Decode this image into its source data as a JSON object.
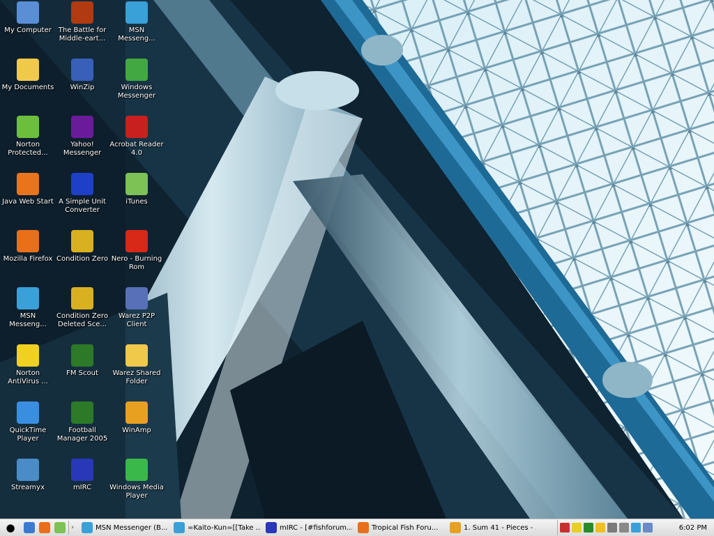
{
  "desktop": {
    "icons": [
      {
        "label": "My Computer",
        "icon": "my-computer-icon",
        "color": "#5a8fd6"
      },
      {
        "label": "The Battle for Middle-eart...",
        "icon": "battle-middle-earth-icon",
        "color": "#b23a10"
      },
      {
        "label": "MSN Messeng...",
        "icon": "msn-messenger-icon",
        "color": "#3aa0d8"
      },
      {
        "label": "My Documents",
        "icon": "my-documents-icon",
        "color": "#f0c84a"
      },
      {
        "label": "WinZip",
        "icon": "winzip-icon",
        "color": "#3860b8"
      },
      {
        "label": "Windows Messenger",
        "icon": "windows-messenger-icon",
        "color": "#42a842"
      },
      {
        "label": "Norton Protected...",
        "icon": "norton-recycle-bin-icon",
        "color": "#6cbf3c"
      },
      {
        "label": "Yahoo! Messenger",
        "icon": "yahoo-messenger-icon",
        "color": "#6a1b9a"
      },
      {
        "label": "Acrobat Reader 4.0",
        "icon": "acrobat-reader-icon",
        "color": "#c8201e"
      },
      {
        "label": "Java Web Start",
        "icon": "java-web-start-icon",
        "color": "#e8741e"
      },
      {
        "label": "A Simple Unit Converter",
        "icon": "unit-converter-icon",
        "color": "#1e3fc8"
      },
      {
        "label": "iTunes",
        "icon": "itunes-icon",
        "color": "#7cc254"
      },
      {
        "label": "Mozilla Firefox",
        "icon": "firefox-icon",
        "color": "#e8701a"
      },
      {
        "label": "Condition Zero",
        "icon": "condition-zero-icon",
        "color": "#d8b020"
      },
      {
        "label": "Nero - Burning Rom",
        "icon": "nero-icon",
        "color": "#d82818"
      },
      {
        "label": "MSN Messeng...",
        "icon": "msn-messenger-icon",
        "color": "#3aa0d8"
      },
      {
        "label": "Condition Zero Deleted Sce...",
        "icon": "condition-zero-deleted-scenes-icon",
        "color": "#d8b020"
      },
      {
        "label": "Warez P2P Client",
        "icon": "warez-p2p-icon",
        "color": "#5870b8"
      },
      {
        "label": "Norton AntiVirus ...",
        "icon": "norton-antivirus-icon",
        "color": "#f0d020"
      },
      {
        "label": "FM Scout",
        "icon": "fm-scout-icon",
        "color": "#2c7a28"
      },
      {
        "label": "Warez Shared Folder",
        "icon": "folder-icon",
        "color": "#f0c84a"
      },
      {
        "label": "QuickTime Player",
        "icon": "quicktime-icon",
        "color": "#3a8ee0"
      },
      {
        "label": "Football Manager 2005",
        "icon": "football-manager-icon",
        "color": "#2c7a28"
      },
      {
        "label": "WinAmp",
        "icon": "winamp-icon",
        "color": "#e8a020"
      },
      {
        "label": "Streamyx",
        "icon": "streamyx-icon",
        "color": "#4a8cc8"
      },
      {
        "label": "mIRC",
        "icon": "mirc-icon",
        "color": "#2838b8"
      },
      {
        "label": "Windows Media Player",
        "icon": "windows-media-player-icon",
        "color": "#3ab84a"
      }
    ]
  },
  "taskbar": {
    "start_icon": "start-button-icon",
    "quick_launch": [
      {
        "icon": "show-desktop-icon",
        "color": "#3c7ad0"
      },
      {
        "icon": "firefox-icon",
        "color": "#e8701a"
      },
      {
        "icon": "itunes-icon",
        "color": "#7cc254"
      }
    ],
    "chevron": "›",
    "tasks": [
      {
        "label": "MSN Messenger (B...",
        "icon": "msn-messenger-icon",
        "color": "#3aa0d8"
      },
      {
        "label": "=Kaito-Kun=[[Take ...",
        "icon": "msn-chat-icon",
        "color": "#3aa0d8"
      },
      {
        "label": "mIRC - [#fishforum....",
        "icon": "mirc-icon",
        "color": "#2838b8"
      },
      {
        "label": "Tropical Fish Foru...",
        "icon": "firefox-icon",
        "color": "#e8701a"
      },
      {
        "label": "1. Sum 41 - Pieces - ...",
        "icon": "winamp-icon",
        "color": "#e8a020"
      }
    ],
    "tray_icons": [
      {
        "icon": "network-disconnected-icon",
        "color": "#c83030"
      },
      {
        "icon": "norton-icon",
        "color": "#e8d020"
      },
      {
        "icon": "meter-icon",
        "color": "#2a8a2a"
      },
      {
        "icon": "yahoo-icon",
        "color": "#f0c020"
      },
      {
        "icon": "speaker-icon",
        "color": "#7a7a7a"
      },
      {
        "icon": "printer-icon",
        "color": "#888888"
      },
      {
        "icon": "msn-tray-icon",
        "color": "#3aa0d8"
      },
      {
        "icon": "mail-icon",
        "color": "#6a8ac8"
      }
    ],
    "clock": "6:02 PM"
  }
}
